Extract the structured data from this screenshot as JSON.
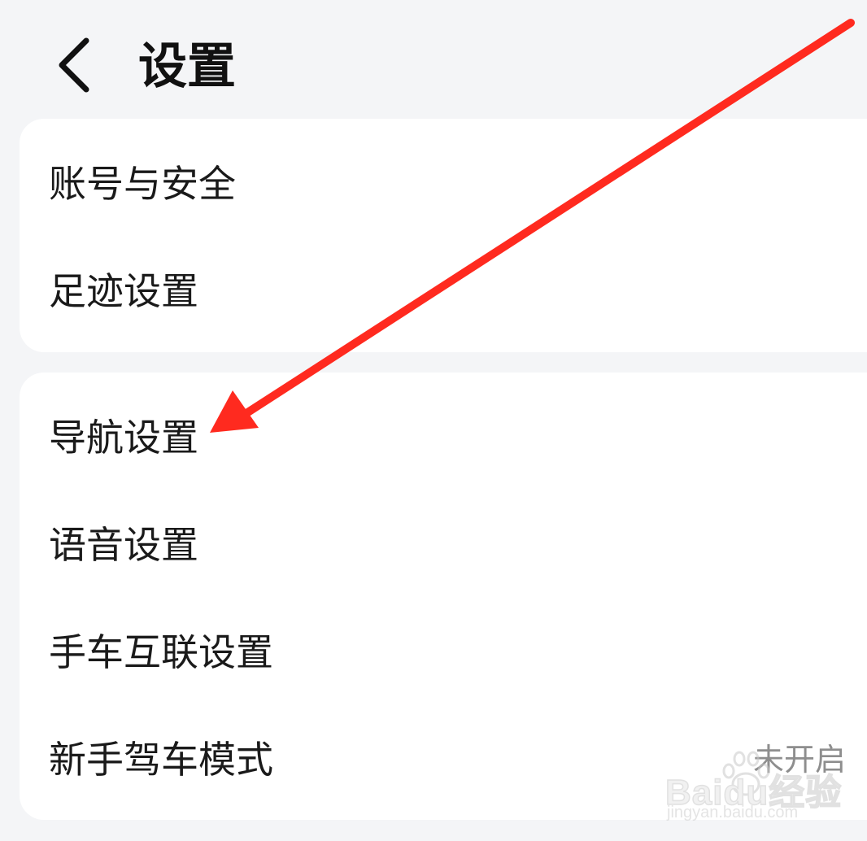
{
  "header": {
    "back_icon": "chevron-left-icon",
    "title": "设置"
  },
  "groups": [
    {
      "items": [
        {
          "label": "账号与安全",
          "value": ""
        },
        {
          "label": "足迹设置",
          "value": ""
        }
      ]
    },
    {
      "items": [
        {
          "label": "导航设置",
          "value": ""
        },
        {
          "label": "语音设置",
          "value": ""
        },
        {
          "label": "手车互联设置",
          "value": ""
        },
        {
          "label": "新手驾车模式",
          "value": "未开启"
        }
      ]
    }
  ],
  "annotation": {
    "arrow_color": "#ff2a1f"
  },
  "watermark": {
    "logo": "Baidu经验",
    "url": "jingyan.baidu.com"
  },
  "colors": {
    "background": "#f4f5f7",
    "card": "#ffffff",
    "text": "#1a1a1a",
    "secondary_text": "#8e8e8e"
  }
}
